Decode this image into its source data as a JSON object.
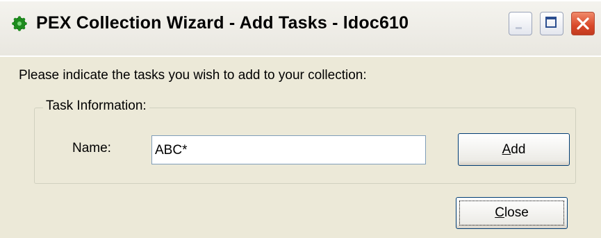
{
  "window": {
    "title": "PEX Collection Wizard - Add Tasks - ldoc610",
    "icon": "green-gear-icon",
    "controls": {
      "minimize": "minimize",
      "maximize": "maximize",
      "close": "close"
    }
  },
  "instruction": "Please indicate the tasks you wish to add to your collection:",
  "task_group": {
    "legend": "Task Information:",
    "name_label": "Name:",
    "name_value": "ABC*"
  },
  "buttons": {
    "add": {
      "mnemonic": "A",
      "rest": "dd"
    },
    "close": {
      "mnemonic": "C",
      "rest": "lose"
    }
  },
  "colors": {
    "close_button": "#d9482a",
    "accent": "#003c74"
  }
}
